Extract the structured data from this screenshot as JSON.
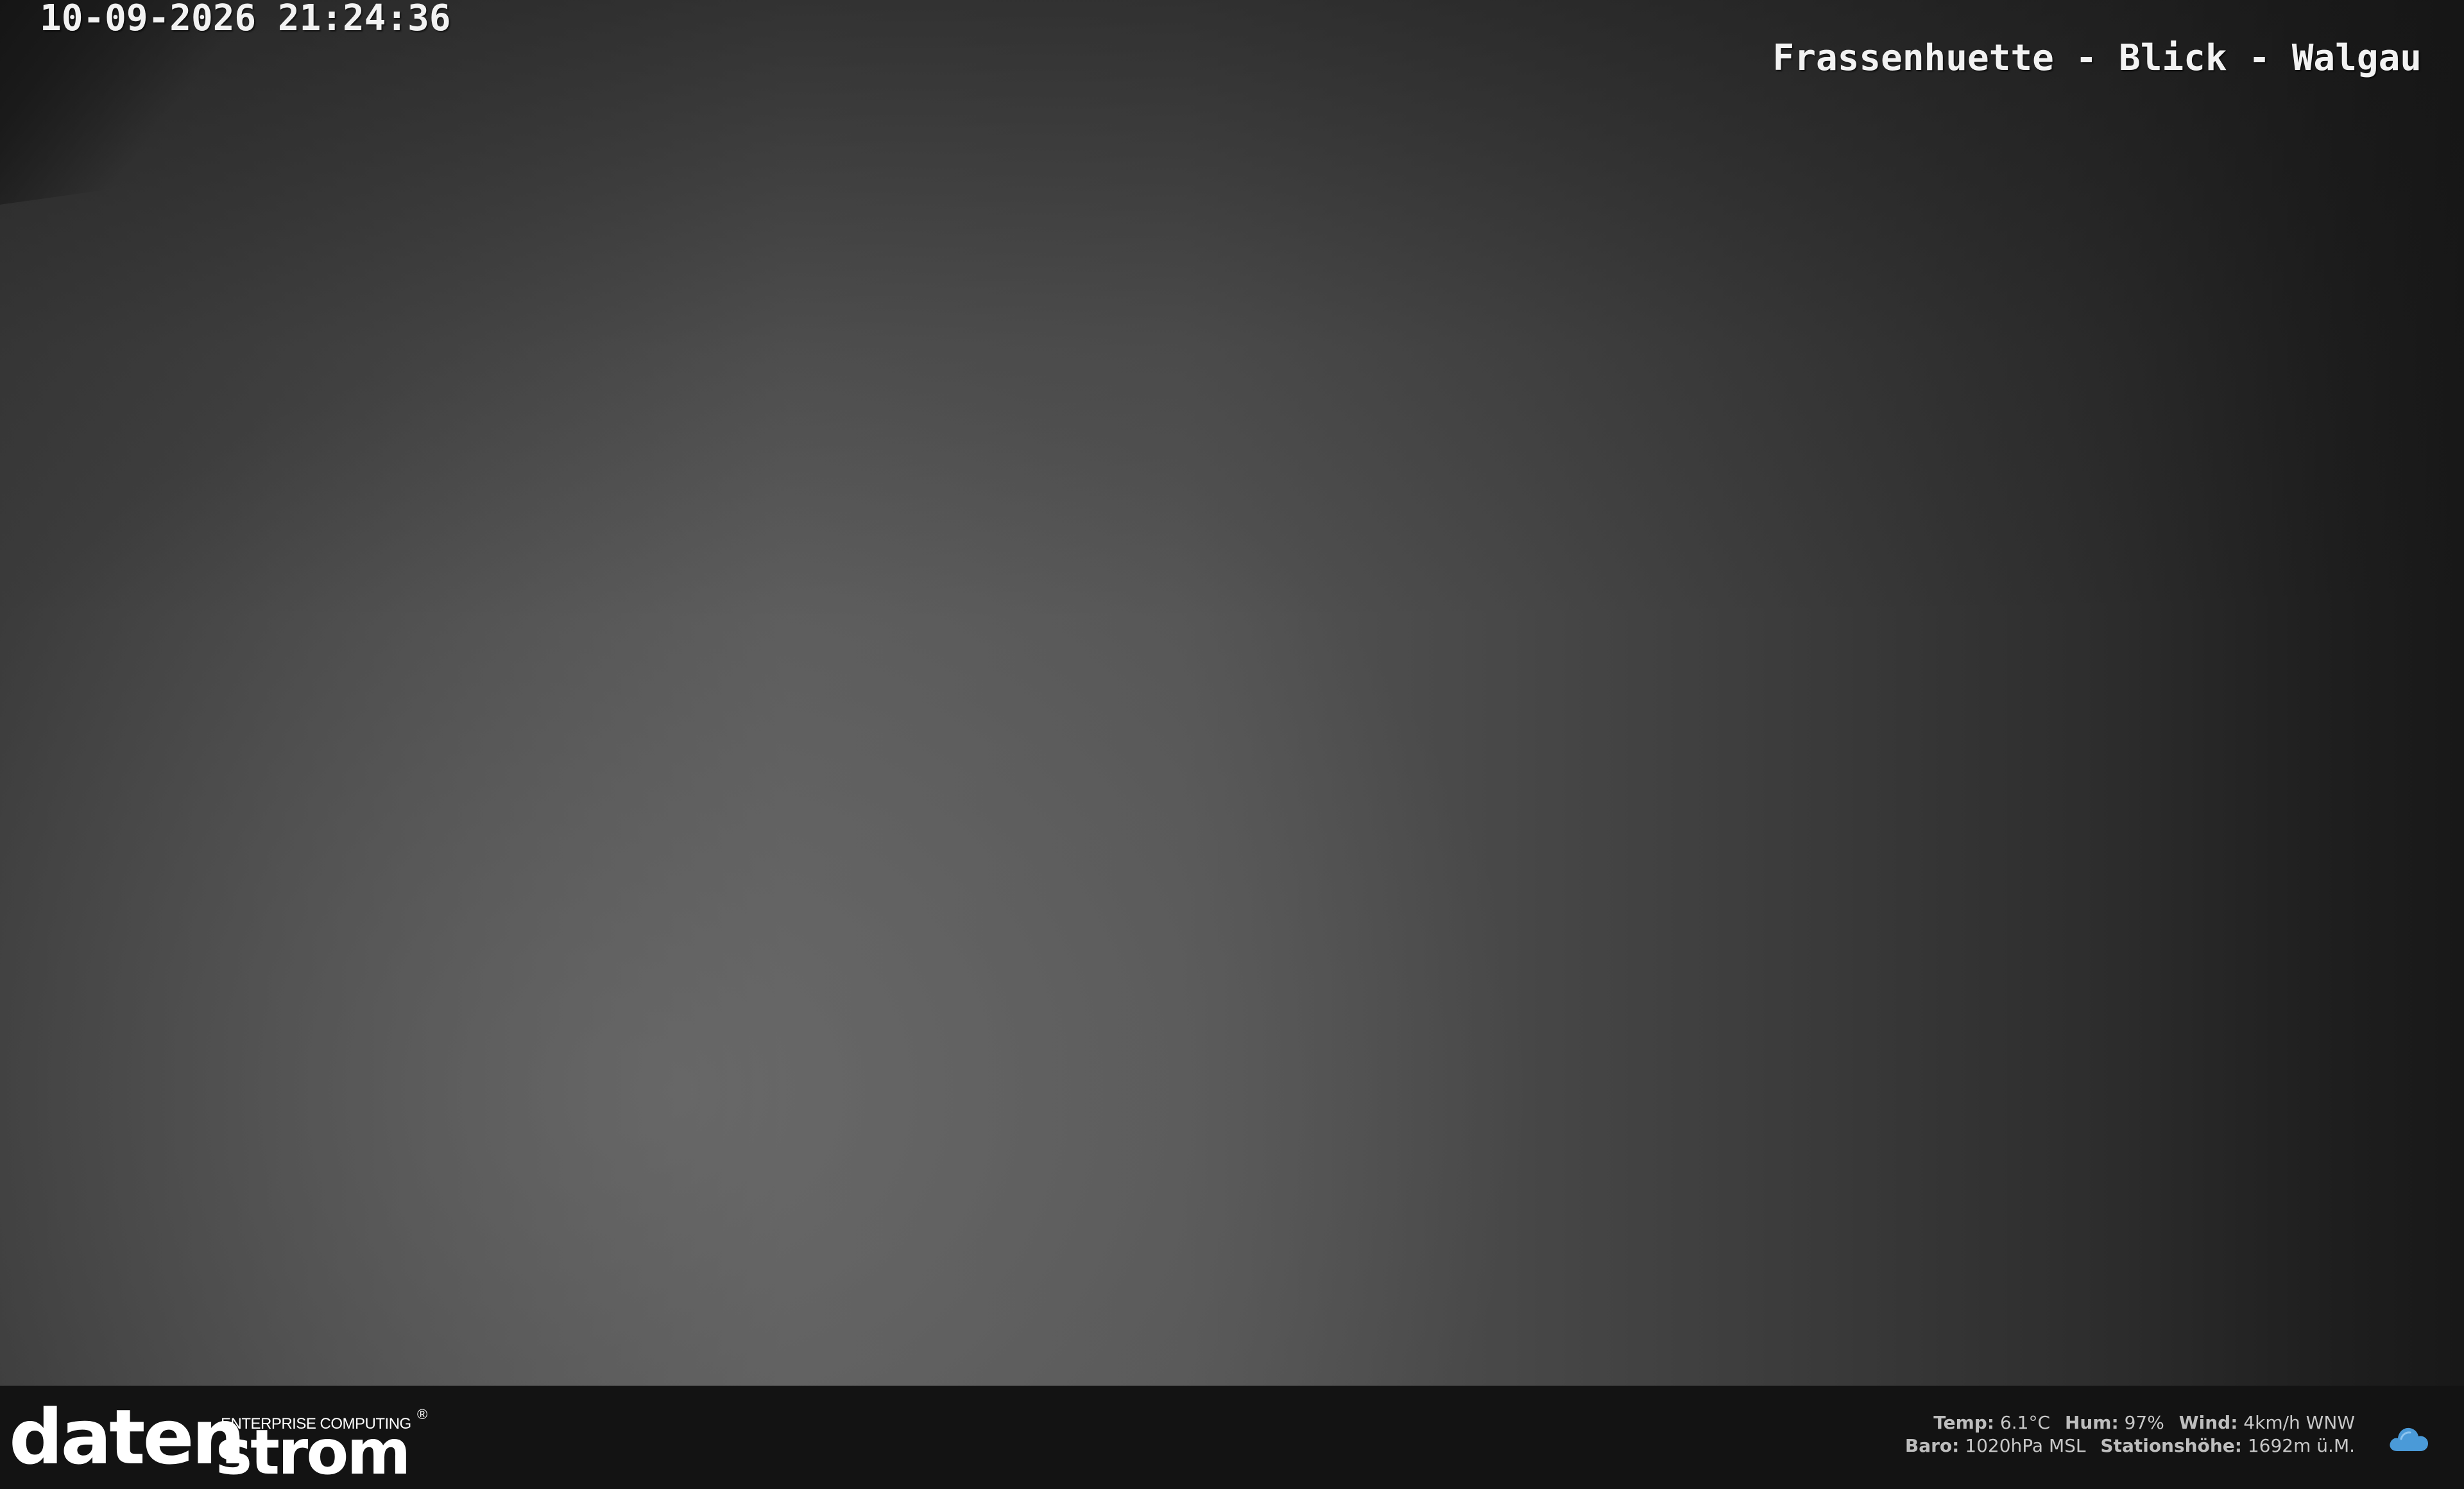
{
  "overlay": {
    "timestamp": "10-09-2026 21:24:36",
    "location_title": "Frassenhuette - Blick - Walgau"
  },
  "branding": {
    "logo_primary": "daten",
    "logo_secondary": "strom",
    "tagline": "ENTERPRISE COMPUTING",
    "registered_mark": "®"
  },
  "weather": {
    "temp_label": "Temp:",
    "temp_value": "6.1°C",
    "hum_label": "Hum:",
    "hum_value": "97%",
    "wind_label": "Wind:",
    "wind_value": "4km/h WNW",
    "baro_label": "Baro:",
    "baro_value": "1020hPa MSL",
    "station_label": "Stationshöhe:",
    "station_value": "1692m ü.M.",
    "icon": "cloud-icon",
    "icon_color": "#4a9ad8"
  }
}
